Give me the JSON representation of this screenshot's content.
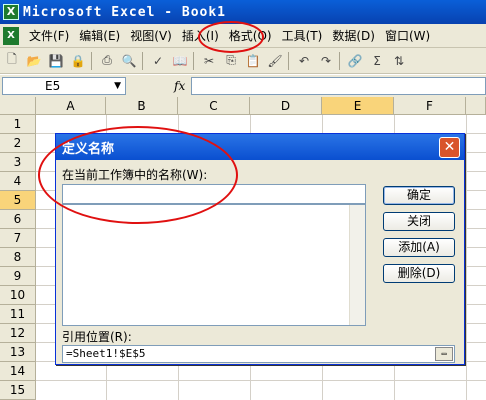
{
  "window": {
    "app_icon": "excel-icon",
    "title": "Microsoft Excel - Book1"
  },
  "menu": {
    "grip_icon": "excel-doc-icon",
    "items": [
      {
        "label": "文件",
        "key": "(F)"
      },
      {
        "label": "编辑",
        "key": "(E)"
      },
      {
        "label": "视图",
        "key": "(V)"
      },
      {
        "label": "插入",
        "key": "(I)"
      },
      {
        "label": "格式",
        "key": "(O)"
      },
      {
        "label": "工具",
        "key": "(T)"
      },
      {
        "label": "数据",
        "key": "(D)"
      },
      {
        "label": "窗口",
        "key": "(W)"
      }
    ]
  },
  "toolbar": {
    "icons": [
      "new-icon",
      "open-icon",
      "save-icon",
      "permission-icon",
      "print-icon",
      "print-preview-icon",
      "spelling-icon",
      "research-icon",
      "cut-icon",
      "copy-icon",
      "paste-icon",
      "format-painter-icon",
      "undo-icon",
      "redo-icon",
      "hyperlink-icon",
      "autosum-icon",
      "sort-icon"
    ]
  },
  "formula_bar": {
    "name_box_value": "E5",
    "fx_label": "fx",
    "formula_value": ""
  },
  "sheet": {
    "columns": [
      "A",
      "B",
      "C",
      "D",
      "E",
      "F"
    ],
    "active_column": "E",
    "rows": [
      "1",
      "2",
      "3",
      "4",
      "5",
      "6",
      "7",
      "8",
      "9",
      "10",
      "11",
      "12",
      "13",
      "14",
      "15"
    ],
    "active_row": "5"
  },
  "dialog": {
    "title": "定义名称",
    "names_label": "在当前工作簿中的名称(W):",
    "name_value": "",
    "buttons": {
      "ok": "确定",
      "close": "关闭",
      "add": "添加(A)",
      "delete": "删除(D)"
    },
    "refers_to_label": "引用位置(R):",
    "refers_to_value": "=Sheet1!$E$5"
  },
  "annotations": {
    "color": "#e01010"
  }
}
